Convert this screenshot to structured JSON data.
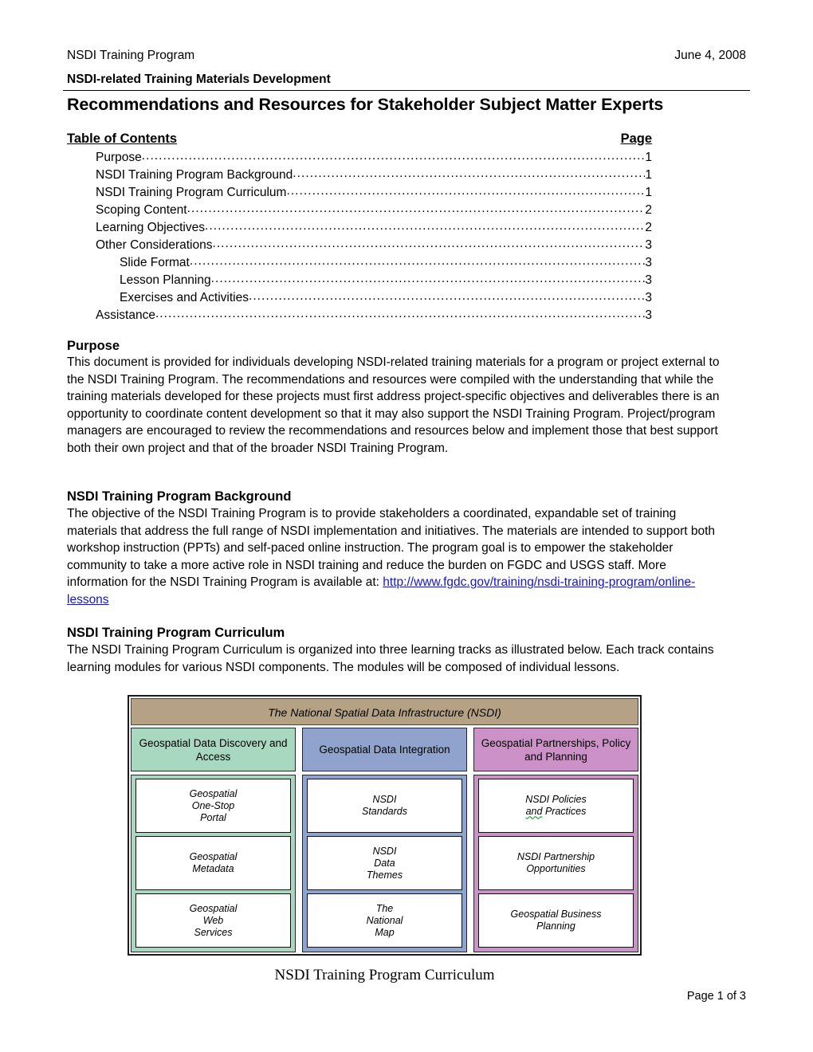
{
  "header": {
    "left": "NSDI Training Program",
    "right": "June 4, 2008"
  },
  "titles": {
    "subtitle": "NSDI-related Training Materials Development",
    "main": "Recommendations and Resources for Stakeholder Subject Matter Experts"
  },
  "toc": {
    "title": "Table of Contents",
    "page_col": "Page",
    "entries": [
      {
        "label": "Purpose",
        "page": "1",
        "level": 1
      },
      {
        "label": "NSDI Training Program Background",
        "page": "1",
        "level": 1
      },
      {
        "label": "NSDI Training Program Curriculum",
        "page": "1",
        "level": 1
      },
      {
        "label": "Scoping Content",
        "page": "2",
        "level": 1
      },
      {
        "label": "Learning Objectives",
        "page": "2",
        "level": 1
      },
      {
        "label": "Other Considerations",
        "page": "3",
        "level": 1
      },
      {
        "label": "Slide Format",
        "page": "3",
        "level": 2
      },
      {
        "label": "Lesson Planning",
        "page": "3",
        "level": 2
      },
      {
        "label": "Exercises and Activities",
        "page": "3",
        "level": 2
      },
      {
        "label": "Assistance",
        "page": "3",
        "level": 1
      }
    ]
  },
  "sections": {
    "purpose": {
      "heading": "Purpose",
      "body": "This document is provided for individuals developing NSDI-related training materials for a program or project external to the NSDI Training Program. The recommendations and resources were compiled with the understanding that while the training materials developed for these projects must first address project-specific objectives and deliverables there is an opportunity to coordinate content development so that it may also support the NSDI Training Program. Project/program managers are encouraged to review the recommendations and resources below and implement those that best support both their own project and that of the broader NSDI Training Program."
    },
    "background": {
      "heading": "NSDI Training Program Background",
      "body_before_link": "The objective of the NSDI Training Program is to provide stakeholders a coordinated, expandable set of training materials that address the full range of NSDI implementation and initiatives. The materials are intended to support both workshop instruction (PPTs) and self-paced online instruction. The program goal is to empower the stakeholder community to take a more active role in NSDI training and reduce the burden on FGDC and USGS staff. More information for the NSDI Training Program is available at: ",
      "link_text": "http://www.fgdc.gov/training/nsdi-training-program/online-lessons"
    },
    "curriculum": {
      "heading": "NSDI Training Program Curriculum",
      "body": "The NSDI Training Program Curriculum is organized into three learning tracks as illustrated below. Each track contains learning modules for various NSDI components. The modules will be composed of individual lessons."
    }
  },
  "diagram": {
    "banner": "The National Spatial Data Infrastructure (NSDI)",
    "banner_color": "#b5a184",
    "caption": "NSDI Training Program Curriculum",
    "tracks": [
      {
        "title": "Geospatial Data Discovery and Access",
        "color": "#a8d9c0",
        "modules": [
          "Geospatial\nOne-Stop\nPortal",
          "Geospatial\nMetadata",
          "Geospatial\nWeb\nServices"
        ]
      },
      {
        "title": "Geospatial Data Integration",
        "color": "#8fa3cd",
        "modules": [
          "NSDI\nStandards",
          "NSDI\nData\nThemes",
          "The\nNational\nMap"
        ]
      },
      {
        "title": "Geospatial Partnerships, Policy and Planning",
        "color": "#cc92c8",
        "modules": [
          "NSDI Policies\nand Practices",
          "NSDI Partnership\nOpportunities",
          "Geospatial Business\nPlanning"
        ]
      }
    ]
  },
  "footer": {
    "page_label": "Page 1 of 3"
  }
}
